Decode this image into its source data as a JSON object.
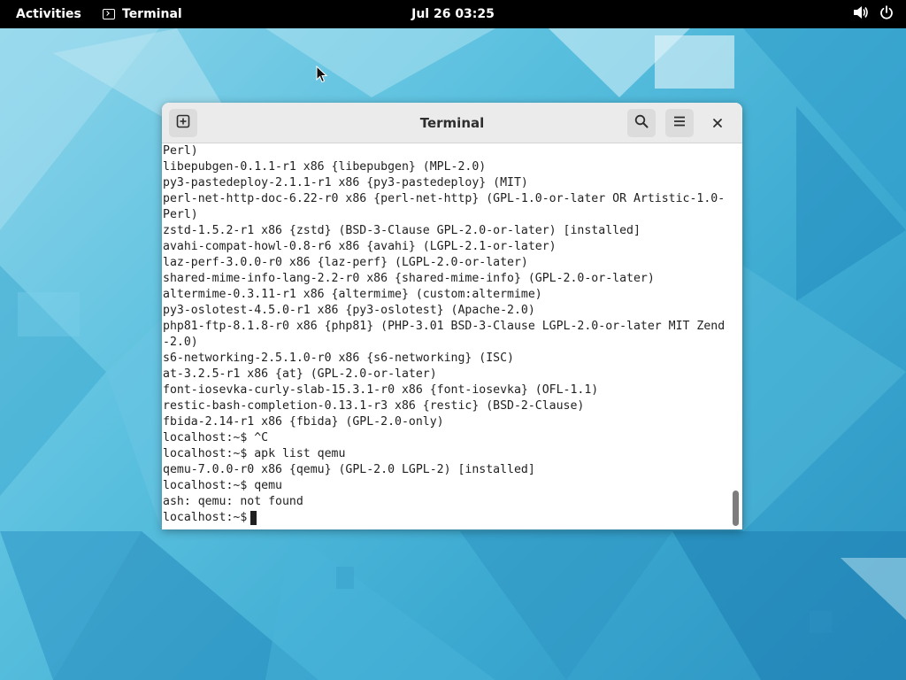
{
  "topbar": {
    "activities": "Activities",
    "app_name": "Terminal",
    "clock": "Jul 26  03:25",
    "icons": [
      "terminal-icon",
      "volume-icon",
      "power-icon"
    ]
  },
  "window": {
    "title": "Terminal",
    "icons": [
      "new-tab-icon",
      "search-icon",
      "hamburger-menu-icon",
      "close-icon"
    ]
  },
  "terminal": {
    "lines": [
      "Perl)",
      "libepubgen-0.1.1-r1 x86 {libepubgen} (MPL-2.0)",
      "py3-pastedeploy-2.1.1-r1 x86 {py3-pastedeploy} (MIT)",
      "perl-net-http-doc-6.22-r0 x86 {perl-net-http} (GPL-1.0-or-later OR Artistic-1.0-",
      "Perl)",
      "zstd-1.5.2-r1 x86 {zstd} (BSD-3-Clause GPL-2.0-or-later) [installed]",
      "avahi-compat-howl-0.8-r6 x86 {avahi} (LGPL-2.1-or-later)",
      "laz-perf-3.0.0-r0 x86 {laz-perf} (LGPL-2.0-or-later)",
      "shared-mime-info-lang-2.2-r0 x86 {shared-mime-info} (GPL-2.0-or-later)",
      "altermime-0.3.11-r1 x86 {altermime} (custom:altermime)",
      "py3-oslotest-4.5.0-r1 x86 {py3-oslotest} (Apache-2.0)",
      "php81-ftp-8.1.8-r0 x86 {php81} (PHP-3.01 BSD-3-Clause LGPL-2.0-or-later MIT Zend",
      "-2.0)",
      "s6-networking-2.5.1.0-r0 x86 {s6-networking} (ISC)",
      "at-3.2.5-r1 x86 {at} (GPL-2.0-or-later)",
      "font-iosevka-curly-slab-15.3.1-r0 x86 {font-iosevka} (OFL-1.1)",
      "restic-bash-completion-0.13.1-r3 x86 {restic} (BSD-2-Clause)",
      "fbida-2.14-r1 x86 {fbida} (GPL-2.0-only)",
      "localhost:~$ ^C",
      "localhost:~$ apk list qemu",
      "qemu-7.0.0-r0 x86 {qemu} (GPL-2.0 LGPL-2) [installed]",
      "localhost:~$ qemu",
      "ash: qemu: not found"
    ],
    "prompt": "localhost:~$"
  }
}
